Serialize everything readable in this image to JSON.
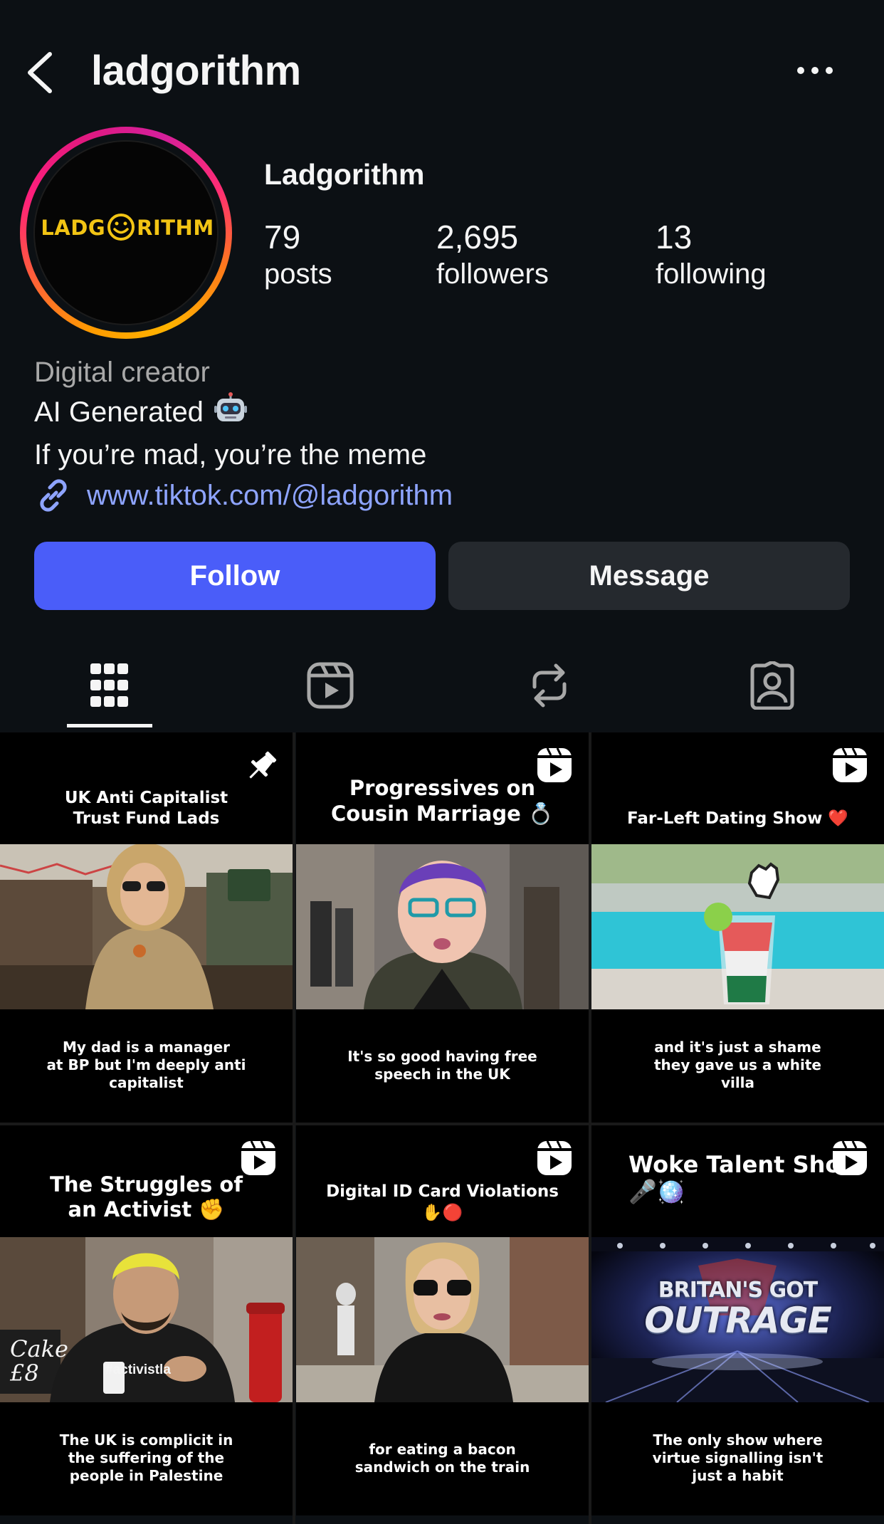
{
  "header": {
    "username": "ladgorithm",
    "back_icon": "chevron-left-icon",
    "more_icon": "more-horizontal-icon"
  },
  "profile": {
    "avatar_logo_left": "LADG",
    "avatar_logo_right": "RITHM",
    "display_name": "Ladgorithm",
    "stats": [
      {
        "value": "79",
        "label": "posts"
      },
      {
        "value": "2,695",
        "label": "followers"
      },
      {
        "value": "13",
        "label": "following"
      }
    ],
    "category": "Digital creator",
    "bio_line1": "AI Generated",
    "bio_line2": "If you’re mad, you’re the meme",
    "link": "www.tiktok.com/@ladgorithm"
  },
  "actions": {
    "follow": "Follow",
    "message": "Message"
  },
  "tabs": [
    {
      "name": "posts-grid",
      "icon": "grid-icon",
      "active": true
    },
    {
      "name": "reels",
      "icon": "reels-icon",
      "active": false
    },
    {
      "name": "reposts",
      "icon": "repost-icon",
      "active": false
    },
    {
      "name": "tagged",
      "icon": "tagged-person-icon",
      "active": false
    }
  ],
  "posts": [
    {
      "title": "UK Anti Capitalist\nTrust Fund Lads",
      "caption": "My dad is a manager\nat BP but I'm deeply anti\ncapitalist",
      "badge": "pin-icon"
    },
    {
      "title": "Progressives on\nCousin Marriage 💍",
      "caption": "It's so good having free\nspeech in the UK",
      "badge": "reel-icon"
    },
    {
      "title": "Far-Left Dating Show ❤️",
      "caption": "and it's just a shame\nthey gave us a white\nvilla",
      "badge": "reel-icon"
    },
    {
      "title": "The Struggles of\nan Activist ✊",
      "caption": "The UK is complicit in\nthe suffering of the\npeople in Palestine",
      "badge": "reel-icon",
      "photo_text_sign": "Cake\n£8",
      "photo_text_hoodie": "#activistla"
    },
    {
      "title": "Digital ID Card Violations\n✋🔴",
      "caption": "for eating a bacon\nsandwich on the train",
      "badge": "reel-icon"
    },
    {
      "title": "Woke Talent Show\n🎤🪩",
      "caption": "The only show where\nvirtue signalling isn't\njust a habit",
      "badge": "reel-icon",
      "photo_text_line1": "BRITAN'S GOT",
      "photo_text_line2": "OUTRAGE"
    }
  ],
  "colors": {
    "background": "#0c1014",
    "follow_button": "#4a5df9",
    "message_button": "#25292e",
    "link": "#8ea4ff",
    "logo_yellow": "#f2c414"
  }
}
